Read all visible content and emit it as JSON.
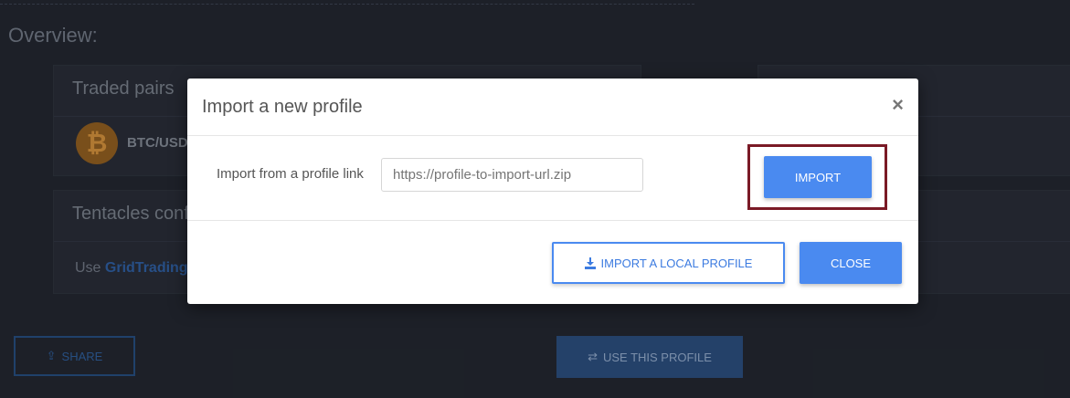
{
  "background": {
    "overview_title": "Overview:",
    "traded_pairs_title": "Traded pairs",
    "pair_name": "BTC/USD",
    "coin_symbol": "₿",
    "tentacles_title": "Tentacles conf",
    "use_text": "Use",
    "use_link": "GridTrading",
    "share_label": "SHARE",
    "use_profile_label": "USE THIS PROFILE"
  },
  "modal": {
    "title": "Import a new profile",
    "close_icon": "×",
    "import_label": "Import from a profile link",
    "url_placeholder": "https://profile-to-import-url.zip",
    "import_button": "IMPORT",
    "local_button": "IMPORT A LOCAL PROFILE",
    "close_button": "CLOSE"
  },
  "colors": {
    "accent": "#4a8af0",
    "highlight": "#7a1a26"
  }
}
